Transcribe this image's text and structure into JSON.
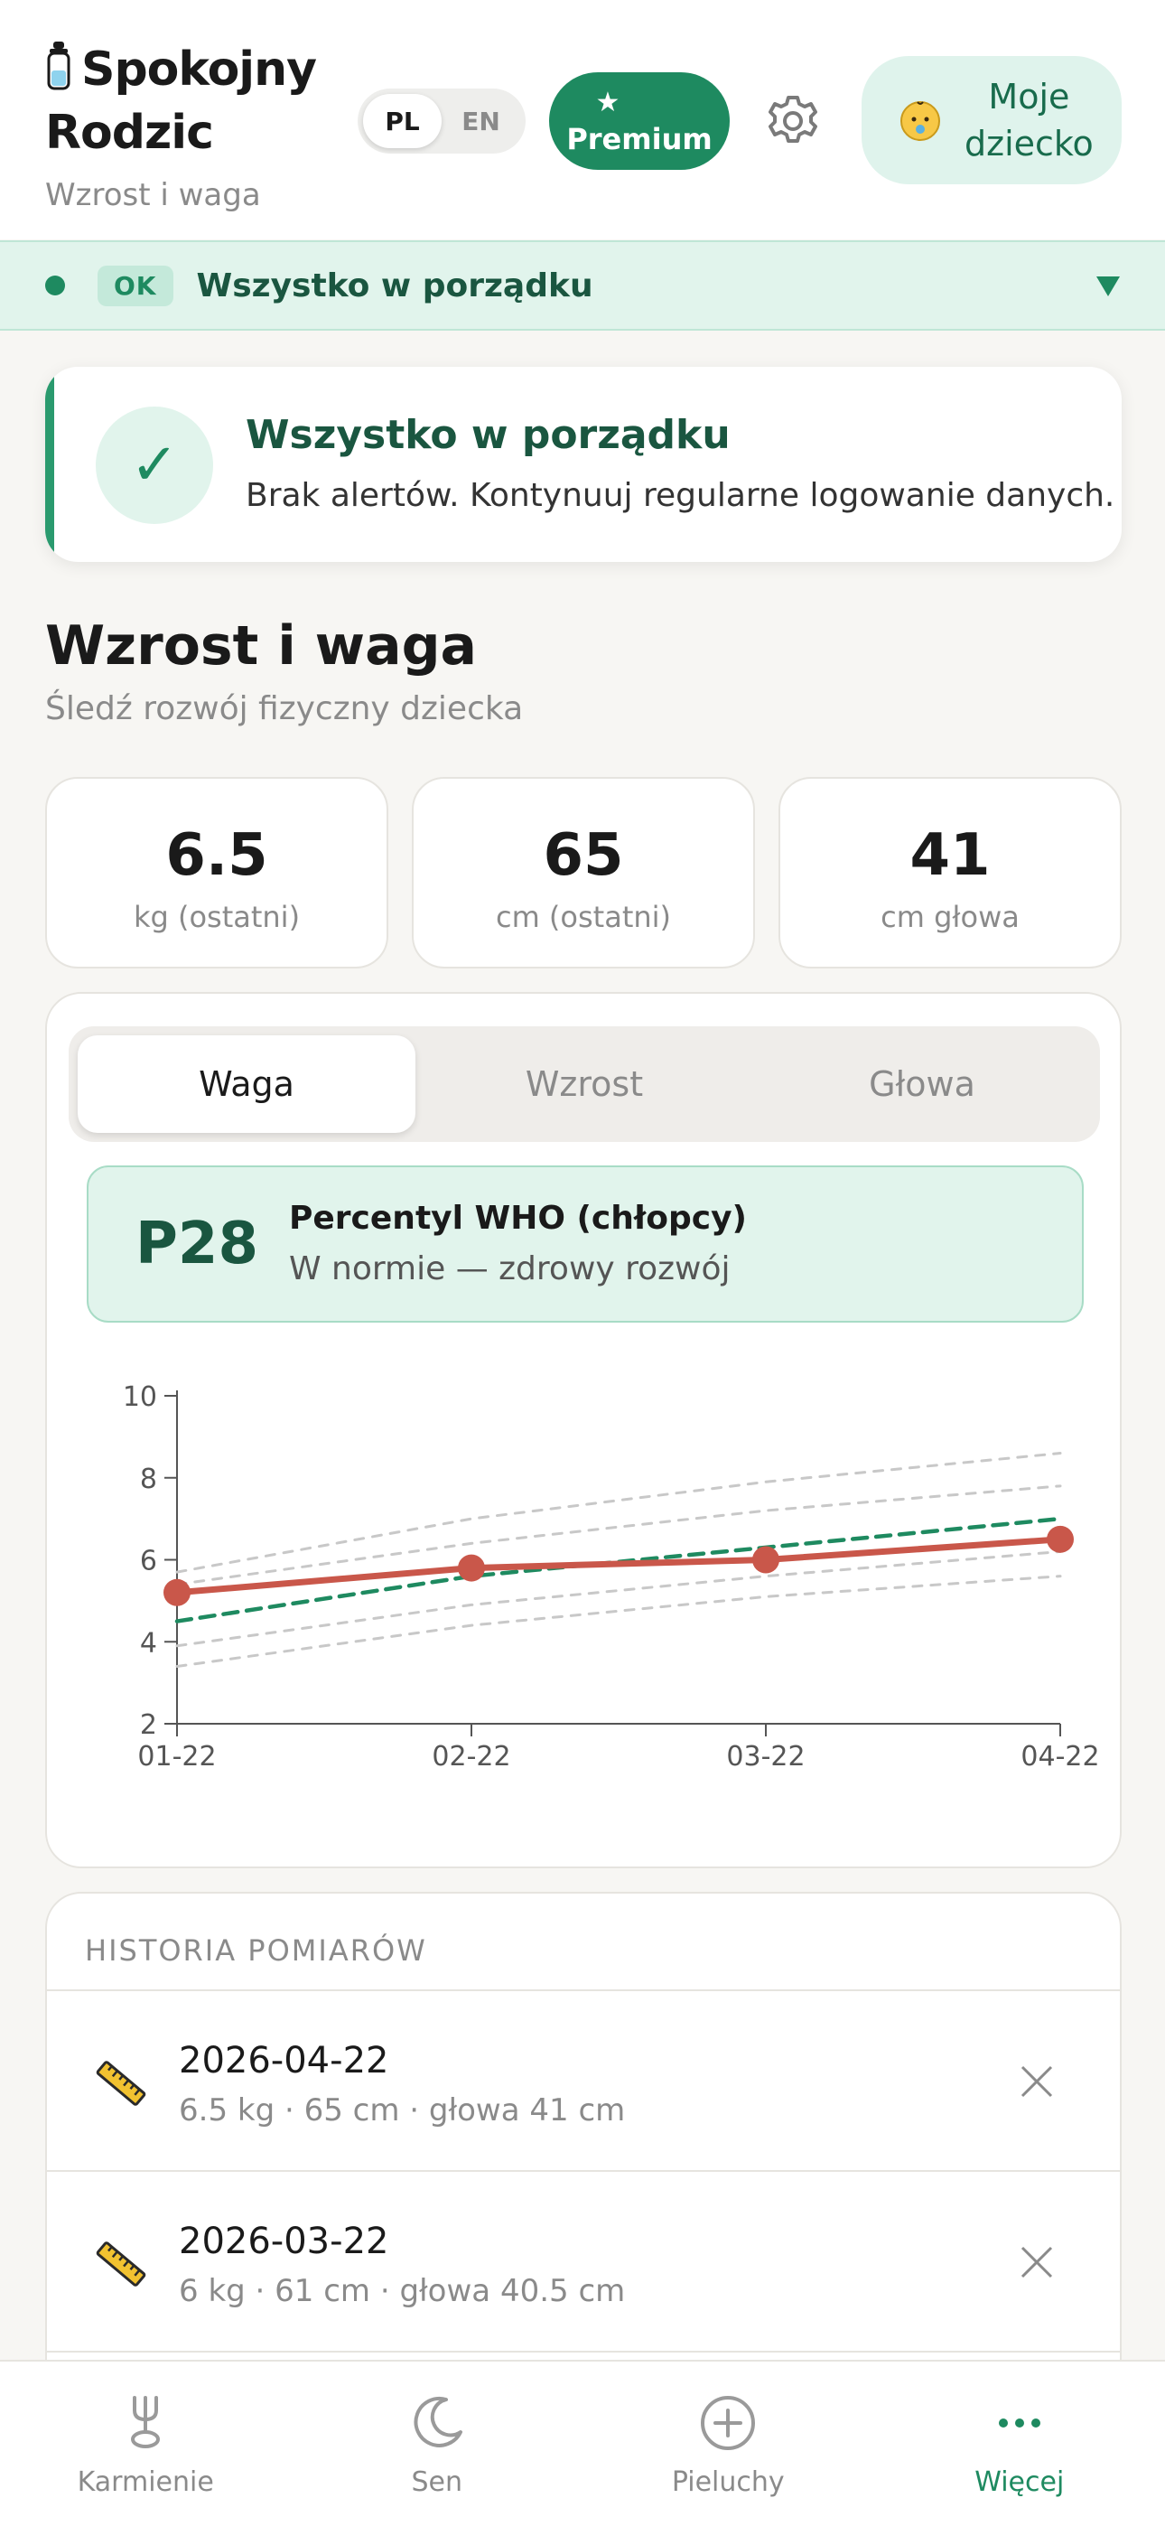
{
  "header": {
    "app_name_line1": "Spokojny",
    "app_name_line2": "Rodzic",
    "subtitle": "Wzrost i waga",
    "lang_options": [
      "PL",
      "EN"
    ],
    "lang_active": "PL",
    "premium_label": "Premium",
    "premium_icon": "star-icon",
    "settings_icon": "gear-icon",
    "child_button_line1": "Moje",
    "child_button_line2": "dziecko",
    "child_icon": "baby-face-icon"
  },
  "status_strip": {
    "badge": "OK",
    "text": "Wszystko w porządku",
    "color": "#1e8a60"
  },
  "alert": {
    "title": "Wszystko w porządku",
    "body": "Brak alertów. Kontynuuj regularne logowanie danych.",
    "icon": "check-icon"
  },
  "section": {
    "title": "Wzrost i waga",
    "subtitle": "Śledź rozwój fizyczny dziecka"
  },
  "stats": [
    {
      "value": "6.5",
      "label": "kg (ostatni)"
    },
    {
      "value": "65",
      "label": "cm (ostatni)"
    },
    {
      "value": "41",
      "label": "cm głowa"
    }
  ],
  "tabs": [
    "Waga",
    "Wzrost",
    "Głowa"
  ],
  "active_tab": "Waga",
  "percentile": {
    "value": "P28",
    "title": "Percentyl WHO (chłopcy)",
    "subtitle": "W normie — zdrowy rozwój"
  },
  "chart_data": {
    "type": "line",
    "x": [
      "01-22",
      "02-22",
      "03-22",
      "04-22"
    ],
    "ylim": [
      2,
      10
    ],
    "yticks": [
      2,
      4,
      6,
      8,
      10
    ],
    "series": [
      {
        "values": [
          5.2,
          5.8,
          6.0,
          6.5
        ],
        "color": "#c9574a",
        "style": "solid",
        "markers": true
      },
      {
        "values": [
          4.5,
          5.6,
          6.3,
          7.0
        ],
        "color": "#1e8a60",
        "style": "dashed"
      },
      {
        "values": [
          5.7,
          7.0,
          7.9,
          8.6
        ],
        "color": "#c8c8c8",
        "style": "dashed"
      },
      {
        "values": [
          5.4,
          6.4,
          7.2,
          7.8
        ],
        "color": "#c8c8c8",
        "style": "dashed"
      },
      {
        "values": [
          3.9,
          4.9,
          5.6,
          6.2
        ],
        "color": "#c8c8c8",
        "style": "dashed"
      },
      {
        "values": [
          3.4,
          4.4,
          5.1,
          5.6
        ],
        "color": "#c8c8c8",
        "style": "dashed"
      }
    ]
  },
  "history": {
    "title": "HISTORIA POMIARÓW",
    "rows": [
      {
        "date": "2026-04-22",
        "detail": "6.5 kg · 65 cm · głowa 41 cm"
      },
      {
        "date": "2026-03-22",
        "detail": "6 kg · 61 cm · głowa 40.5 cm"
      }
    ]
  },
  "nav": [
    {
      "label": "Karmienie",
      "icon": "feeding-icon"
    },
    {
      "label": "Sen",
      "icon": "moon-icon"
    },
    {
      "label": "Pieluchy",
      "icon": "plus-circle-icon"
    },
    {
      "label": "Więcej",
      "icon": "more-dots-icon",
      "active": true
    }
  ]
}
